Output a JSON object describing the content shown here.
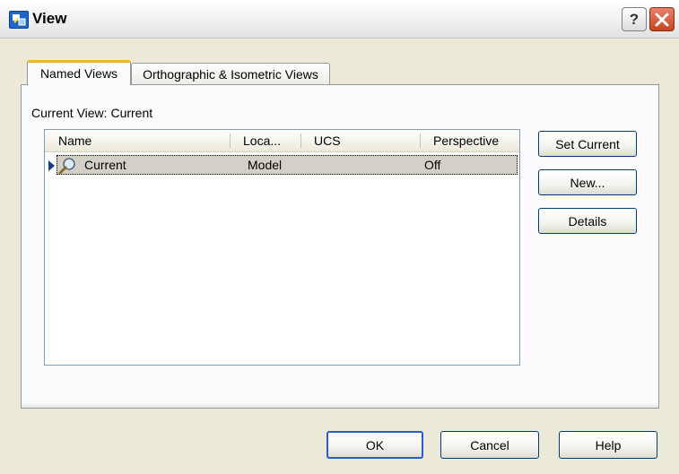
{
  "window": {
    "title": "View",
    "help_glyph": "?",
    "icon": "view-dialog-icon",
    "close_icon": "close-icon"
  },
  "tabs": [
    {
      "label": "Named Views",
      "active": true
    },
    {
      "label": "Orthographic & Isometric Views",
      "active": false
    }
  ],
  "current_view": {
    "label": "Current View:",
    "value": "Current"
  },
  "list": {
    "columns": [
      "Name",
      "Loca...",
      "UCS",
      "Perspective"
    ],
    "rows": [
      {
        "name": "Current",
        "location": "Model",
        "ucs": "",
        "perspective": "Off",
        "icon": "magnifier-icon",
        "selected": true
      }
    ]
  },
  "side_buttons": {
    "set_current": "Set Current",
    "new": "New...",
    "details": "Details"
  },
  "bottom_buttons": {
    "ok": "OK",
    "cancel": "Cancel",
    "help": "Help"
  },
  "colors": {
    "tab_highlight": "#f6b231",
    "close_button": "#c6451e",
    "default_button_border": "#2c5cc5",
    "selected_row": "#d4d0c8"
  }
}
